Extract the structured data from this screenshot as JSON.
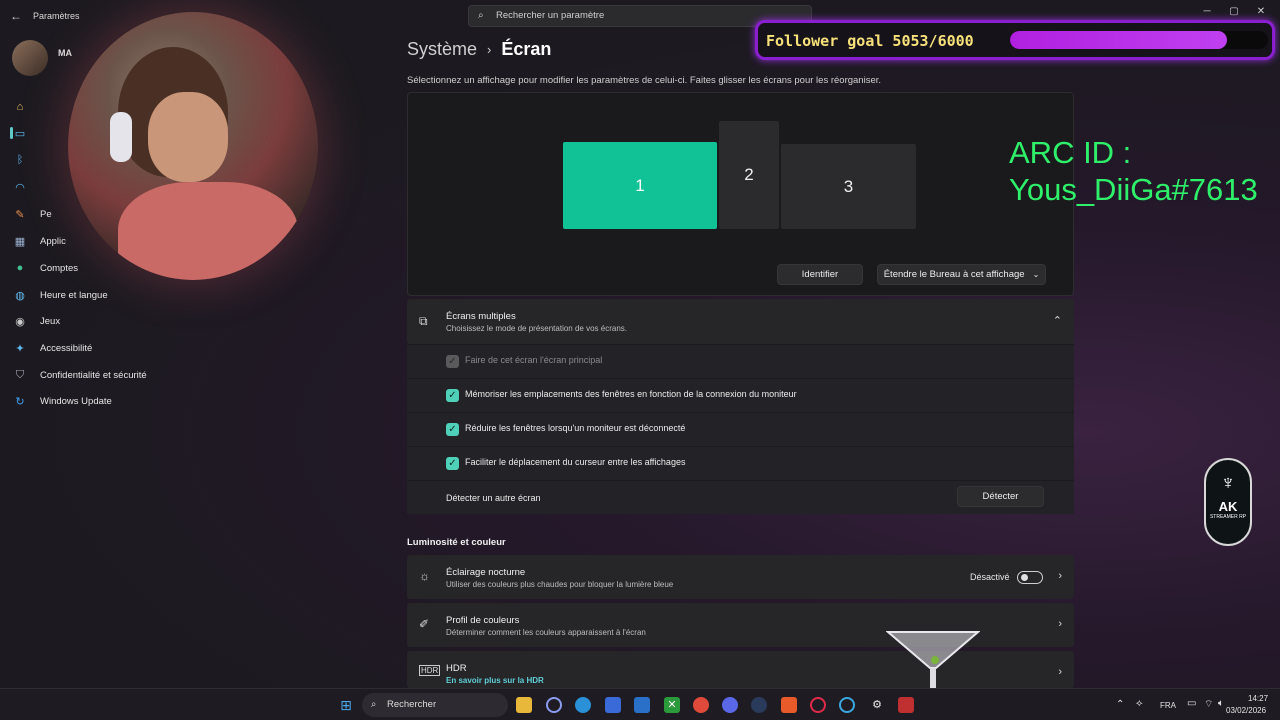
{
  "window": {
    "app_title": "Paramètres",
    "search_placeholder": "Rechercher un paramètre",
    "minimize": "─",
    "maximize": "▢",
    "close": "✕"
  },
  "profile": {
    "name": "MA"
  },
  "sidebar": {
    "items": [
      {
        "label": "",
        "icon": "home-icon"
      },
      {
        "label": "",
        "icon": "system-icon"
      },
      {
        "label": "",
        "icon": "bluetooth-icon"
      },
      {
        "label": "",
        "icon": "network-icon"
      },
      {
        "label": "Pe",
        "icon": "personalization-icon"
      },
      {
        "label": "Applic",
        "icon": "apps-icon"
      },
      {
        "label": "Comptes",
        "icon": "accounts-icon"
      },
      {
        "label": "Heure et langue",
        "icon": "time-language-icon"
      },
      {
        "label": "Jeux",
        "icon": "gaming-icon"
      },
      {
        "label": "Accessibilité",
        "icon": "accessibility-icon"
      },
      {
        "label": "Confidentialité et sécurité",
        "icon": "privacy-icon"
      },
      {
        "label": "Windows Update",
        "icon": "update-icon"
      }
    ]
  },
  "breadcrumb": {
    "parent": "Système",
    "separator": "›",
    "current": "Écran"
  },
  "subtitle": "Sélectionnez un affichage pour modifier les paramètres de celui-ci. Faites glisser les écrans pour les réorganiser.",
  "displays": {
    "monitor_1": "1",
    "monitor_2": "2",
    "monitor_3": "3"
  },
  "display_actions": {
    "identify": "Identifier",
    "extend": "Étendre le Bureau à cet affichage"
  },
  "multiple_displays": {
    "title": "Écrans multiples",
    "description": "Choisissez le mode de présentation de vos écrans.",
    "options": [
      {
        "label": "Faire de cet écran l'écran principal",
        "checked": true,
        "disabled": true
      },
      {
        "label": "Mémoriser les emplacements des fenêtres en fonction de la connexion du moniteur",
        "checked": true,
        "disabled": false
      },
      {
        "label": "Réduire les fenêtres lorsqu'un moniteur est déconnecté",
        "checked": true,
        "disabled": false
      },
      {
        "label": "Faciliter le déplacement du curseur entre les affichages",
        "checked": true,
        "disabled": false
      }
    ],
    "detect_label": "Détecter un autre écran",
    "detect_button": "Détecter"
  },
  "brightness_section": {
    "title": "Luminosité et couleur",
    "night_light": {
      "title": "Éclairage nocturne",
      "description": "Utiliser des couleurs plus chaudes pour bloquer la lumière bleue",
      "state": "Désactivé"
    },
    "color_profile": {
      "title": "Profil de couleurs",
      "description": "Déterminer comment les couleurs apparaissent à l'écran"
    },
    "hdr": {
      "title": "HDR",
      "link": "En savoir plus sur la HDR"
    }
  },
  "overlay": {
    "follower_goal": "Follower goal 5053/6000",
    "follower_progress": 0.842,
    "arc_id": "ARC ID :\nYous_DiiGa#7613",
    "logo_text": "AK",
    "logo_sub": "STREAMER RP"
  },
  "taskbar": {
    "search": "Rechercher",
    "language": "FRA",
    "time": "14:27",
    "date": "03/02/2026"
  },
  "colors": {
    "accent": "#12c297",
    "checkbox": "#4fd0b8",
    "overlay_green": "#2ff06a",
    "goal_border": "#8a1fd0"
  }
}
